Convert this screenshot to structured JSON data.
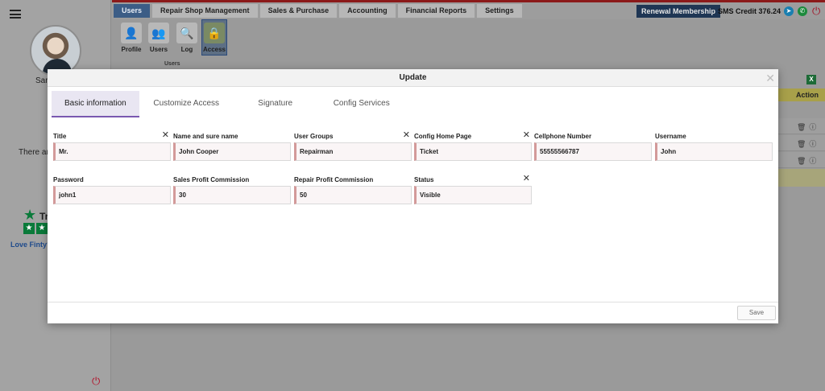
{
  "sidebar": {
    "name_partial": "Sar",
    "notice_partial": "There ar",
    "trustpilot_partial": "Tr",
    "love_text": "Love Finty?"
  },
  "topbar": {
    "tabs": [
      "Users",
      "Repair Shop Management",
      "Sales & Purchase",
      "Accounting",
      "Financial Reports",
      "Settings"
    ],
    "active_tab": "Users",
    "renew_label": "Renewal Membership",
    "sms_credit": "SMS Credit 376.24"
  },
  "ribbon": {
    "buttons": [
      "Profile",
      "Users",
      "Log",
      "Access"
    ],
    "active": "Access",
    "group_label": "Users"
  },
  "background_table": {
    "action_header": "Action"
  },
  "modal": {
    "title": "Update",
    "tabs": [
      "Basic information",
      "Customize Access",
      "Signature",
      "Config Services"
    ],
    "active_tab": "Basic information",
    "fields": {
      "title": {
        "label": "Title",
        "value": "Mr."
      },
      "name": {
        "label": "Name and sure name",
        "value": "John Cooper"
      },
      "user_groups": {
        "label": "User Groups",
        "value": "Repairman"
      },
      "config_home": {
        "label": "Config Home Page",
        "value": "Ticket"
      },
      "cellphone": {
        "label": "Cellphone Number",
        "value": "55555566787"
      },
      "username": {
        "label": "Username",
        "value": "John"
      },
      "password": {
        "label": "Password",
        "value": "john1"
      },
      "sales_commission": {
        "label": "Sales Profit Commission",
        "value": "30"
      },
      "repair_commission": {
        "label": "Repair Profit Commission",
        "value": "50"
      },
      "status": {
        "label": "Status",
        "value": "Visible"
      }
    },
    "save_label": "Save"
  },
  "colors": {
    "active_tab": "#7a58b0",
    "field_accent": "#d39a9a",
    "header_red": "#8b1a1a"
  }
}
